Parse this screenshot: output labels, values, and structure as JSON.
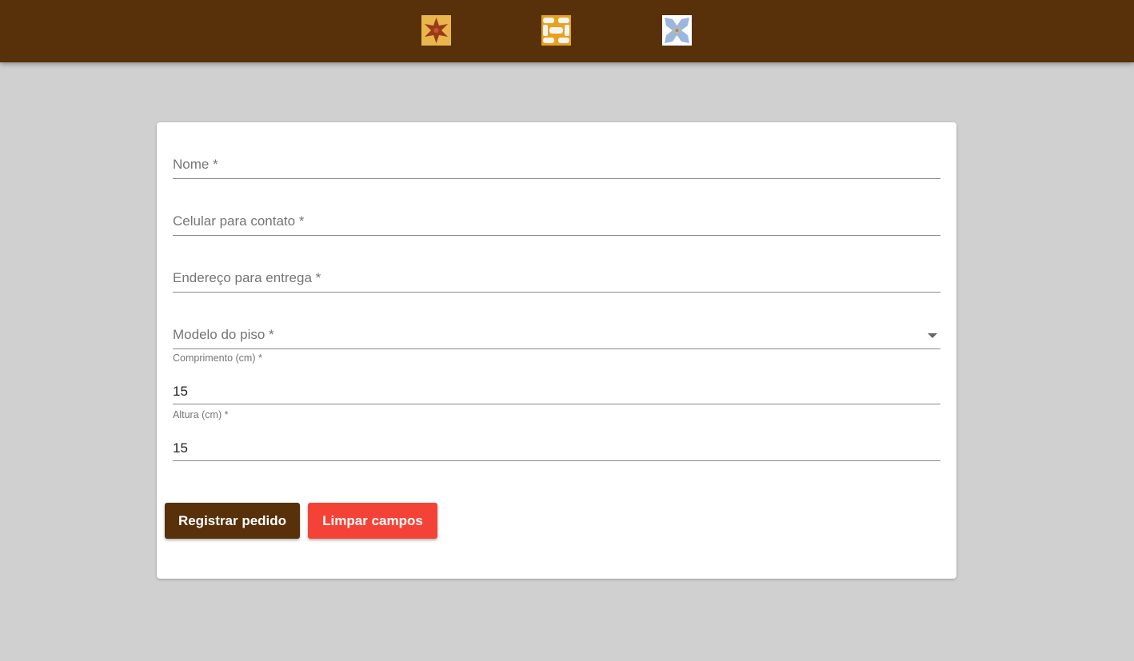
{
  "header": {
    "tiles": [
      {
        "name": "tile-star-pattern",
        "colors": [
          "#e8b64a",
          "#9a3a1c"
        ]
      },
      {
        "name": "tile-interlock-pattern",
        "colors": [
          "#f0f0f0",
          "#e8a21c"
        ]
      },
      {
        "name": "tile-blue-ornament-pattern",
        "colors": [
          "#ffffff",
          "#9bb7e0"
        ]
      }
    ]
  },
  "form": {
    "nome": {
      "placeholder": "Nome *",
      "value": ""
    },
    "celular": {
      "placeholder": "Celular para contato *",
      "value": ""
    },
    "endereco": {
      "placeholder": "Endereço para entrega *",
      "value": ""
    },
    "modelo": {
      "placeholder": "Modelo do piso *",
      "value": ""
    },
    "comprimento": {
      "label": "Comprimento (cm) *",
      "value": "15"
    },
    "altura": {
      "label": "Altura (cm) *",
      "value": "15"
    }
  },
  "buttons": {
    "register_label": "Registrar pedido",
    "clear_label": "Limpar campos"
  },
  "colors": {
    "header_bg": "#58300a",
    "page_bg": "#d0d0d0",
    "primary_button": "#58300a",
    "danger_button": "#f44336"
  }
}
